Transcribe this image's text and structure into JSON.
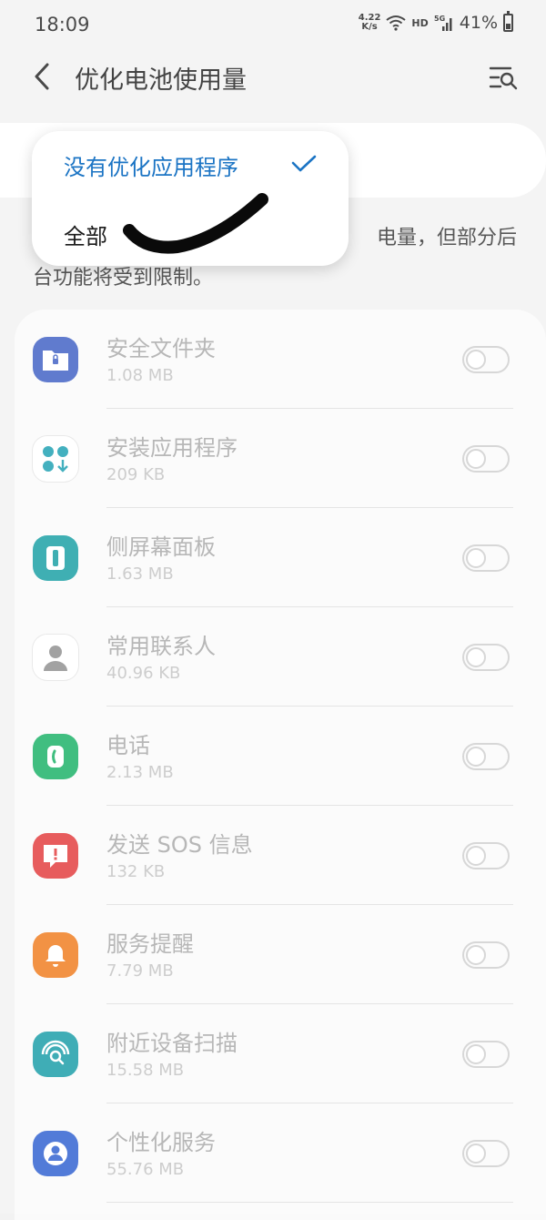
{
  "status_bar": {
    "time": "18:09",
    "net_speed_value": "4.22",
    "net_speed_unit": "K/s",
    "hd_label": "HD",
    "signal_label": "5G",
    "battery": "41%",
    "icons": [
      "wifi-icon",
      "signal-icon",
      "battery-icon"
    ]
  },
  "header": {
    "title": "优化电池使用量",
    "back_icon": "back-arrow-icon",
    "search_icon": "search-filter-icon"
  },
  "dropdown": {
    "options": [
      {
        "label": "没有优化应用程序",
        "selected": true
      },
      {
        "label": "全部",
        "selected": false
      }
    ],
    "selected_color": "#1b74c4"
  },
  "description": {
    "line1_visible": "电量，但部分后",
    "line2": "台功能将受到限制。"
  },
  "apps": [
    {
      "name": "安全文件夹",
      "size": "1.08 MB",
      "icon": "secure-folder-icon",
      "color": "#3d5fc4"
    },
    {
      "name": "安装应用程序",
      "size": "209 KB",
      "icon": "install-apps-icon",
      "color": "#1a9fb1"
    },
    {
      "name": "侧屏幕面板",
      "size": "1.63 MB",
      "icon": "edge-panel-icon",
      "color": "#159ea3"
    },
    {
      "name": "常用联系人",
      "size": "40.96 KB",
      "icon": "contacts-icon",
      "color": "#8e8e8e"
    },
    {
      "name": "电话",
      "size": "2.13 MB",
      "icon": "phone-icon",
      "color": "#16b065"
    },
    {
      "name": "发送 SOS 信息",
      "size": "132 KB",
      "icon": "sos-icon",
      "color": "#e2393a"
    },
    {
      "name": "服务提醒",
      "size": "7.79 MB",
      "icon": "bell-icon",
      "color": "#f07a1c"
    },
    {
      "name": "附近设备扫描",
      "size": "15.58 MB",
      "icon": "nearby-scan-icon",
      "color": "#159ba6"
    },
    {
      "name": "个性化服务",
      "size": "55.76 MB",
      "icon": "personalization-icon",
      "color": "#2d5fd0"
    }
  ]
}
